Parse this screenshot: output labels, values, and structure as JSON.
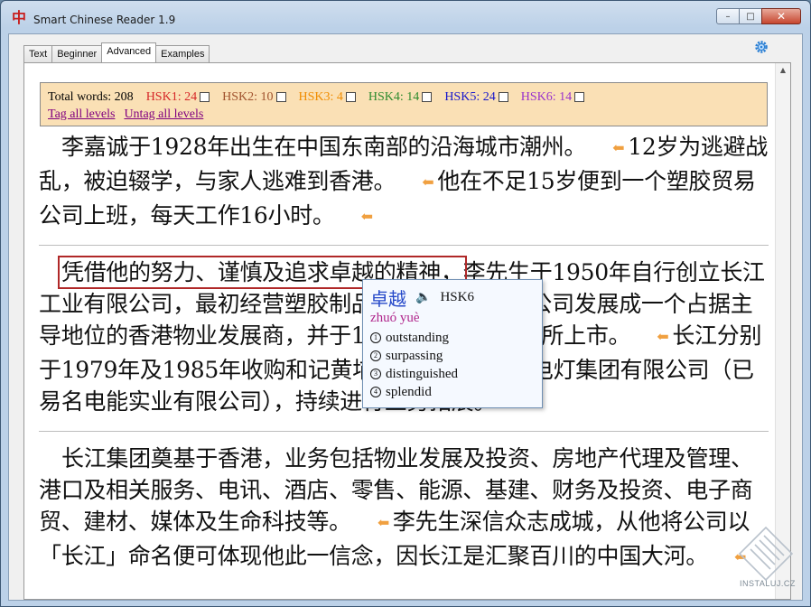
{
  "window": {
    "title": "Smart Chinese Reader 1.9",
    "app_icon_char": "中",
    "minimize_label": "–",
    "maximize_label": "□",
    "close_label": "✕"
  },
  "tabs": [
    {
      "label": "Text",
      "active": false
    },
    {
      "label": "Beginner",
      "active": false
    },
    {
      "label": "Advanced",
      "active": true
    },
    {
      "label": "Examples",
      "active": false
    }
  ],
  "stats": {
    "total_label": "Total words: 208",
    "hsk": [
      {
        "label": "HSK1: 24",
        "color": "#d62728"
      },
      {
        "label": "HSK2: 10",
        "color": "#a0522d"
      },
      {
        "label": "HSK3: 4",
        "color": "#f08c00"
      },
      {
        "label": "HSK4: 14",
        "color": "#2e8b2e"
      },
      {
        "label": "HSK5: 24",
        "color": "#1515cc"
      },
      {
        "label": "HSK6: 14",
        "color": "#9932cc"
      }
    ],
    "tag_all": "Tag all levels",
    "untag_all": "Untag all levels"
  },
  "paragraphs": [
    {
      "segments": [
        {
          "text": "李嘉诚于1928年出生在中国东南部的沿海城市潮州。",
          "hl": false
        },
        {
          "arrow": true
        },
        {
          "text": "12岁为逃避战乱，被迫辍学，与家人逃难到香港。",
          "hl": false
        },
        {
          "arrow": true
        },
        {
          "text": "他在不足15岁便到一个塑胶贸易公司上班，每天工作16小时。",
          "hl": false
        },
        {
          "arrow": true
        }
      ]
    },
    {
      "segments": [
        {
          "text": "凭借他的努力、谨慎及追求卓越的精神，",
          "hl": true
        },
        {
          "text": "李先生于1950年自行创立长江工业有限公司，最初经营塑胶制品，随后李先生将公司发展成一个占据主导地位的香港物业发展商，并于1972年在联合交易所上市。",
          "hl": false
        },
        {
          "arrow": true
        },
        {
          "text": "长江分别于1979年及1985年收购和记黄埔有限公司及香港电灯集团有限公司（已易名电能实业有限公司），持续进行业务拓展。",
          "hl": false
        },
        {
          "arrow": true
        }
      ]
    },
    {
      "segments": [
        {
          "text": "长江集团奠基于香港，业务包括物业发展及投资、房地产代理及管理、港口及相关服务、电讯、酒店、零售、能源、基建、财务及投资、电子商贸、建材、媒体及生命科技等。",
          "hl": false
        },
        {
          "arrow": true
        },
        {
          "text": "李先生深信众志成城，从他将公司以「长江」命名便可体现他此一信念，因长江是汇聚百川的中国大河。",
          "hl": false
        },
        {
          "arrow": true
        }
      ]
    }
  ],
  "popup": {
    "word": "卓越",
    "level": "HSK6",
    "pinyin": "zhuó yuè",
    "definitions": [
      {
        "num": "1",
        "text": "outstanding"
      },
      {
        "num": "2",
        "text": "surpassing"
      },
      {
        "num": "3",
        "text": "distinguished"
      },
      {
        "num": "4",
        "text": "splendid"
      }
    ]
  },
  "watermark": "INSTALUJ.CZ"
}
